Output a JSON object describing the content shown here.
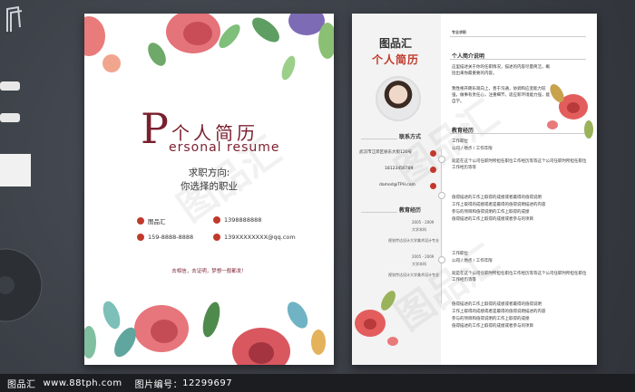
{
  "cover": {
    "title_p": "P",
    "title": "个人简历",
    "subtitle": "ersonal resume",
    "objective_label": "求职方向:",
    "objective_value": "你选择的职业",
    "info": [
      {
        "icon": "user-icon",
        "text": "图品汇"
      },
      {
        "icon": "phone-icon",
        "text": "1398888888"
      },
      {
        "icon": "mobile-icon",
        "text": "159-8888-8888"
      },
      {
        "icon": "email-icon",
        "text": "139XXXXXXXX@qq.com"
      }
    ],
    "motto": "去相信，去证明，梦想一般都发！",
    "watermark": "图品汇"
  },
  "resume": {
    "logo": "图品汇",
    "title": "个人简历",
    "watermark": "图品汇",
    "tag_top": "专业求职",
    "contact_header": "联系方式",
    "contact": [
      {
        "icon": "location-icon",
        "text": "武汉市江岸区徐东大街120号"
      },
      {
        "icon": "phone-icon",
        "text": "18123456789"
      },
      {
        "icon": "email-icon",
        "text": "damod@TPH.com"
      }
    ],
    "edu_header": "教育经历",
    "education": [
      {
        "years": "2005 - 2009",
        "school": "大学本科",
        "major": "视觉传达设计大学美术设计专业"
      },
      {
        "years": "2005 - 2009",
        "school": "大学本科",
        "major": "视觉传达设计大学美术设计专业"
      }
    ],
    "intro_header": "个人简介说明",
    "intro_text": "这里描述关于你的任职情况，描述的内容尽量简洁，概括出来你最重要的内容。",
    "intro_text2": "我性格开朗乐观向上，善于沟通，协调和应变能力较强，做事有责任心，注重细节，适应新环境能力强，能自学。",
    "work_header": "教育经历",
    "jobs": [
      {
        "title": "工作职位",
        "company": "公司 / 地点 / 工作年限",
        "desc": "就是在这个公司任职时所担任职位工作经历等等这个公司任职时所担任职位工作经历等等",
        "bullets": [
          "值得描述的工作上取得的成绩或者最得的值得说明",
          "工作上取得的成绩或者是最得的值得说明描述的内容",
          "参与的项目和值得说明的工作上取得的成绩",
          "值得描述的工作上取得的成绩或者参与的项目"
        ]
      },
      {
        "title": "工作职位",
        "company": "公司 / 地点 / 工作年限",
        "desc": "就是在这个公司任职时所担任职位工作经历等等这个公司任职时所担任职位工作经历等等",
        "bullets": [
          "值得描述的工作上取得的成绩或者最得的值得说明",
          "工作上取得的成绩或者是最得的值得说明描述的内容",
          "参与的项目和值得说明的工作上取得的成绩",
          "值得描述的工作上取得的成绩或者参与的项目"
        ]
      }
    ]
  },
  "footer": {
    "site": "图品汇",
    "url": "www.88tph.com",
    "id_label": "图片编号：",
    "id_value": "12299697"
  },
  "colors": {
    "accent": "#c0392b",
    "dark_red": "#7a1f2e",
    "desk": "#3b3f46"
  }
}
